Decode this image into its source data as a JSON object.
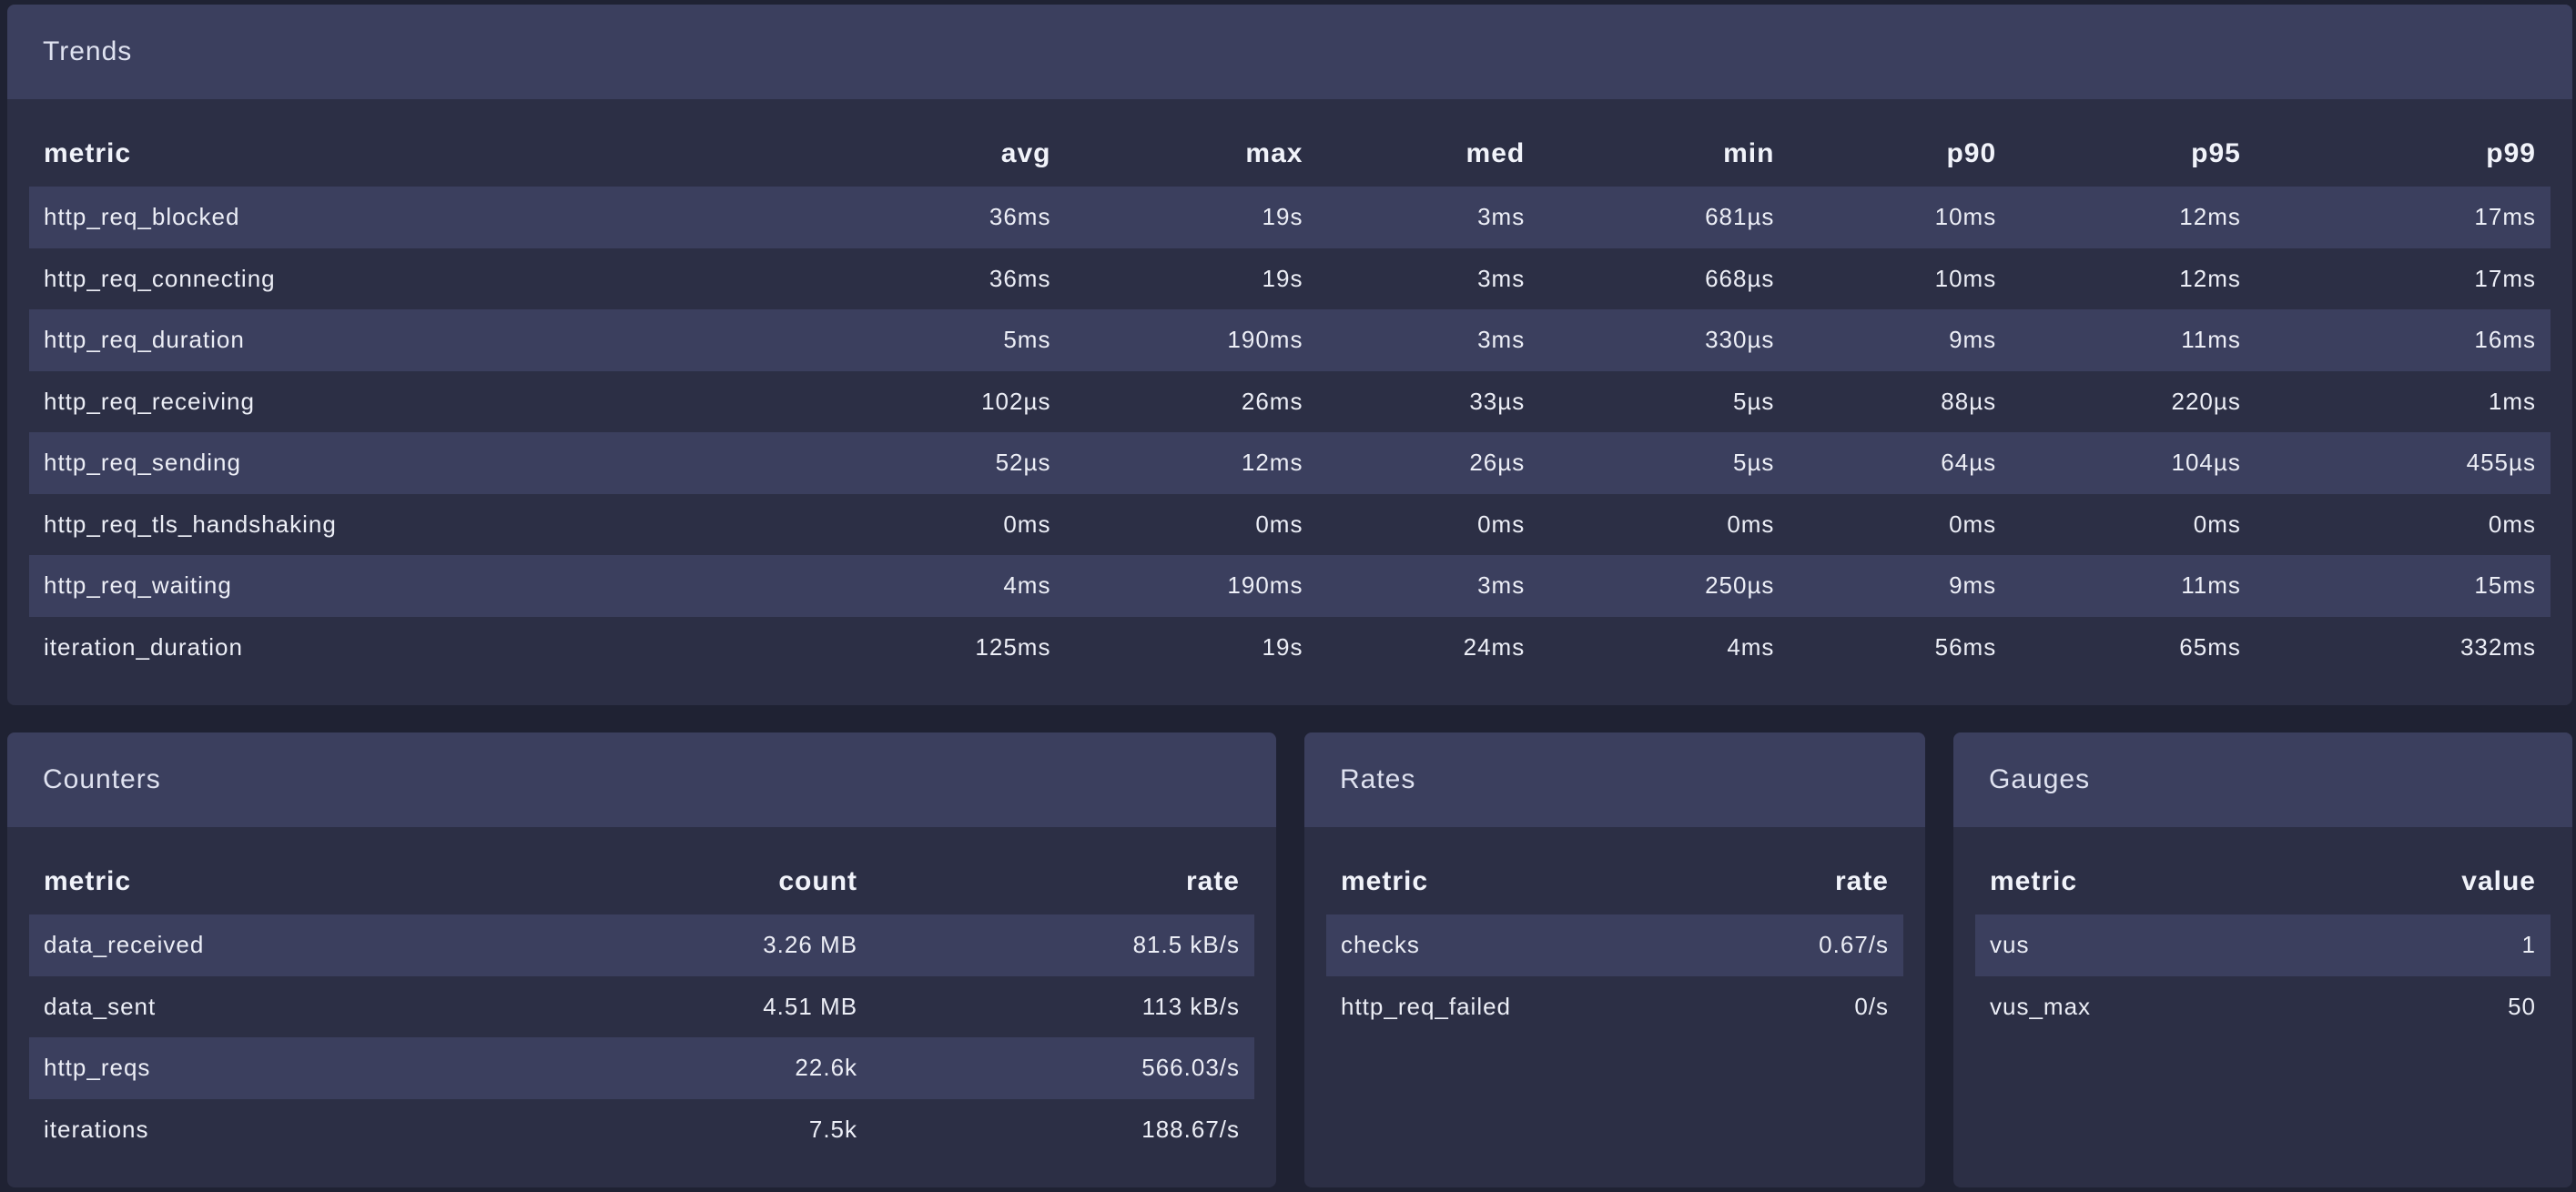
{
  "trends": {
    "title": "Trends",
    "columns": [
      "metric",
      "avg",
      "max",
      "med",
      "min",
      "p90",
      "p95",
      "p99"
    ],
    "rows": [
      [
        "http_req_blocked",
        "36ms",
        "19s",
        "3ms",
        "681µs",
        "10ms",
        "12ms",
        "17ms"
      ],
      [
        "http_req_connecting",
        "36ms",
        "19s",
        "3ms",
        "668µs",
        "10ms",
        "12ms",
        "17ms"
      ],
      [
        "http_req_duration",
        "5ms",
        "190ms",
        "3ms",
        "330µs",
        "9ms",
        "11ms",
        "16ms"
      ],
      [
        "http_req_receiving",
        "102µs",
        "26ms",
        "33µs",
        "5µs",
        "88µs",
        "220µs",
        "1ms"
      ],
      [
        "http_req_sending",
        "52µs",
        "12ms",
        "26µs",
        "5µs",
        "64µs",
        "104µs",
        "455µs"
      ],
      [
        "http_req_tls_handshaking",
        "0ms",
        "0ms",
        "0ms",
        "0ms",
        "0ms",
        "0ms",
        "0ms"
      ],
      [
        "http_req_waiting",
        "4ms",
        "190ms",
        "3ms",
        "250µs",
        "9ms",
        "11ms",
        "15ms"
      ],
      [
        "iteration_duration",
        "125ms",
        "19s",
        "24ms",
        "4ms",
        "56ms",
        "65ms",
        "332ms"
      ]
    ]
  },
  "counters": {
    "title": "Counters",
    "columns": [
      "metric",
      "count",
      "rate"
    ],
    "rows": [
      [
        "data_received",
        "3.26 MB",
        "81.5 kB/s"
      ],
      [
        "data_sent",
        "4.51 MB",
        "113 kB/s"
      ],
      [
        "http_reqs",
        "22.6k",
        "566.03/s"
      ],
      [
        "iterations",
        "7.5k",
        "188.67/s"
      ]
    ]
  },
  "rates": {
    "title": "Rates",
    "columns": [
      "metric",
      "rate"
    ],
    "rows": [
      [
        "checks",
        "0.67/s"
      ],
      [
        "http_req_failed",
        "0/s"
      ]
    ]
  },
  "gauges": {
    "title": "Gauges",
    "columns": [
      "metric",
      "value"
    ],
    "rows": [
      [
        "vus",
        "1"
      ],
      [
        "vus_max",
        "50"
      ]
    ]
  }
}
